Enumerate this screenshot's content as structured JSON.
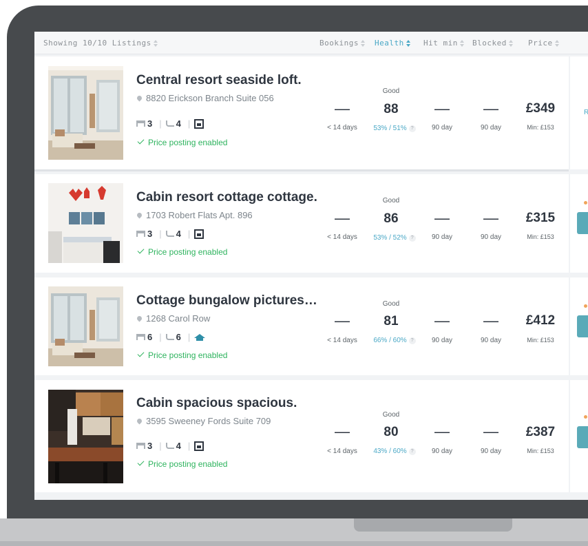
{
  "header": {
    "showing": "Showing 10/10 Listings",
    "bookings": "Bookings",
    "health": "Health",
    "hit_min": "Hit min",
    "blocked": "Blocked",
    "price": "Price"
  },
  "listings": [
    {
      "title": "Central resort seaside loft.",
      "address": "8820 Erickson Branch Suite 056",
      "bedrooms": "3",
      "bathrooms": "4",
      "posting": "Price posting enabled",
      "bookings": "—",
      "bookings_sub": "< 14 days",
      "health_label": "Good",
      "health_score": "88",
      "health_pct": "53% / 51%",
      "hit_min": "—",
      "hit_min_sub": "90 day",
      "blocked": "—",
      "blocked_sub": "90 day",
      "price": "£349",
      "min_price": "Min: £153",
      "side_text": "R"
    },
    {
      "title": "Cabin resort cottage cottage.",
      "address": "1703 Robert Flats Apt. 896",
      "bedrooms": "3",
      "bathrooms": "4",
      "posting": "Price posting enabled",
      "bookings": "—",
      "bookings_sub": "< 14 days",
      "health_label": "Good",
      "health_score": "86",
      "health_pct": "53% / 52%",
      "hit_min": "—",
      "hit_min_sub": "90 day",
      "blocked": "—",
      "blocked_sub": "90 day",
      "price": "£315",
      "min_price": "Min: £153"
    },
    {
      "title": "Cottage bungalow pictures…",
      "address": "1268 Carol Row",
      "bedrooms": "6",
      "bathrooms": "6",
      "posting": "Price posting enabled",
      "bookings": "—",
      "bookings_sub": "< 14 days",
      "health_label": "Good",
      "health_score": "81",
      "health_pct": "66% / 60%",
      "hit_min": "—",
      "hit_min_sub": "90 day",
      "blocked": "—",
      "blocked_sub": "90 day",
      "price": "£412",
      "min_price": "Min: £153"
    },
    {
      "title": "Cabin spacious spacious.",
      "address": "3595 Sweeney Fords Suite 709",
      "bedrooms": "3",
      "bathrooms": "4",
      "posting": "Price posting enabled",
      "bookings": "—",
      "bookings_sub": "< 14 days",
      "health_label": "Good",
      "health_score": "80",
      "health_pct": "43% / 60%",
      "hit_min": "—",
      "hit_min_sub": "90 day",
      "blocked": "—",
      "blocked_sub": "90 day",
      "price": "£387",
      "min_price": "Min: £153"
    }
  ],
  "question_mark": "?",
  "colors": {
    "accent": "#4aa8c6",
    "success": "#2eb35e",
    "frame": "#474a4d",
    "side_button": "#5aaab8",
    "dot": "#f0a45a"
  }
}
